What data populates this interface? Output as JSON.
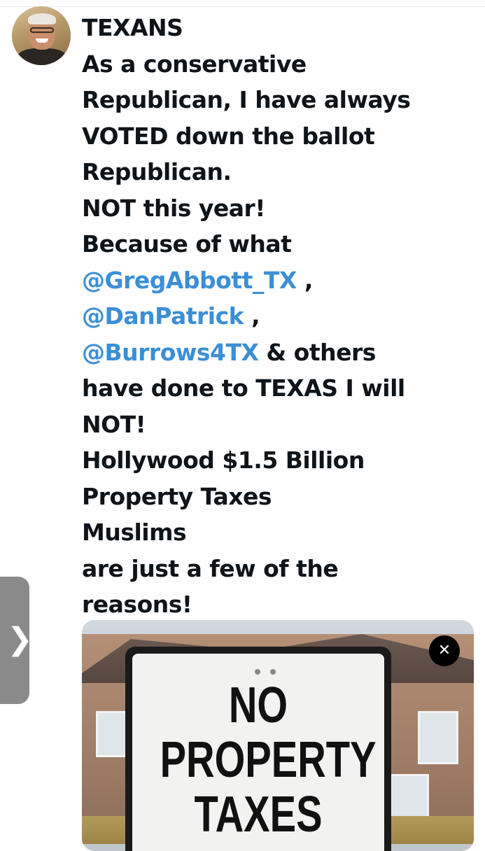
{
  "post": {
    "text_lines": [
      {
        "text": "TEXANS"
      },
      {
        "text": "As a conservative"
      },
      {
        "text": "Republican, I have always"
      },
      {
        "text": "VOTED down the ballot"
      },
      {
        "text": "Republican."
      },
      {
        "text": "NOT this year!"
      },
      {
        "text": "Because of what"
      },
      {
        "mention": "@GregAbbott_TX",
        "after": " ,"
      },
      {
        "mention": "@DanPatrick",
        "after": " ,"
      },
      {
        "mention": "@Burrows4TX",
        "after": " & others"
      },
      {
        "text": "have done to TEXAS I will"
      },
      {
        "text": "NOT!"
      },
      {
        "text": "Hollywood $1.5 Billion"
      },
      {
        "text": "Property Taxes"
      },
      {
        "text": "Muslims"
      },
      {
        "text": "are just a few of the"
      },
      {
        "text": "reasons!"
      }
    ]
  },
  "media": {
    "sign_line_1": "NO",
    "sign_line_2": "PROPERTY",
    "sign_line_3": "TAXES",
    "close_glyph": "✕"
  },
  "side_tab": {
    "chevron": "❯"
  },
  "colors": {
    "mention": "#3b8fd6",
    "text": "#0f1419",
    "side_tab": "#8a8a8a"
  }
}
